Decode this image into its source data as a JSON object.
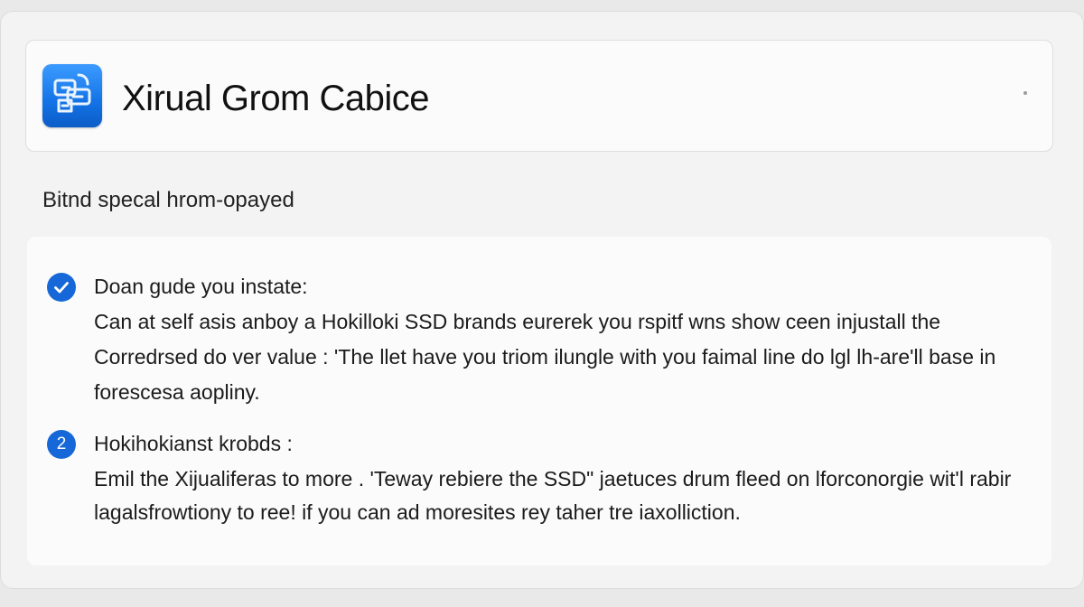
{
  "header": {
    "app_icon": "app-logo-icon",
    "title": "Xirual Grom Cabice"
  },
  "subtitle": "Bitnd specal hrom-opayed",
  "steps": [
    {
      "badge_icon": "checkmark-icon",
      "heading": "Doan gude you instate:",
      "lines": [
        "Can at self asis anboy a Hokilloki SSD brands eurerek you rspitf wns show ceen injustall the",
        "Corredrsed do ver value : 'The llet have you triom ilungle with you faimal line do lgl lh-are'll base in",
        "forescesa aopliny."
      ]
    },
    {
      "badge": "2",
      "heading": "Hokihokianst krobds :",
      "lines": [
        "Emil the Xijualiferas to more . 'Teway rebiere the SSD\" jaetuces drum fleed on lforconorgie wit'l rabir",
        "lagalsfrowtiony to ree! if you can ad moresites rey taher tre iaxolliction."
      ]
    }
  ],
  "colors": {
    "accent": "#1668d8",
    "background": "#f3f3f3",
    "card": "#fbfbfb"
  }
}
